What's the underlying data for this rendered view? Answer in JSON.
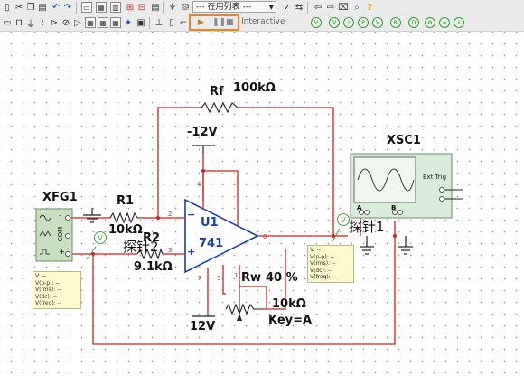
{
  "toolbar": {
    "in_use_list_label": "--- 在用列表 ---",
    "sim_run_icon": "play-icon",
    "sim_pause_icon": "pause-icon",
    "sim_stop_icon": "stop-icon",
    "interactive_label": "Interactive"
  },
  "schematic": {
    "function_generator": {
      "name": "XFG1",
      "terminals": [
        "-",
        "COM",
        "+"
      ]
    },
    "oscilloscope": {
      "name": "XSC1",
      "ext_trig_label": "Ext Trig",
      "channel_a": "A",
      "channel_b": "B"
    },
    "opamp": {
      "ref": "U1",
      "model": "741",
      "minus": "−",
      "plus": "+",
      "pins": [
        "2",
        "3",
        "4",
        "7",
        "6",
        "5",
        "1"
      ]
    },
    "rf": {
      "ref": "Rf",
      "value": "100kΩ"
    },
    "r1": {
      "ref": "R1",
      "value": "10kΩ"
    },
    "r2": {
      "ref": "R2",
      "value": "9.1kΩ"
    },
    "supply_neg": "-12V",
    "supply_pos": "12V",
    "rw": {
      "ref": "Rw",
      "percent": "40 %",
      "value": "10kΩ",
      "key": "Key=A"
    },
    "probe1": {
      "label": "探针1",
      "lines": [
        "V: --",
        "V(p-p): --",
        "V(rms): --",
        "V(dc): --",
        "V(freq): --"
      ]
    },
    "probe2": {
      "label": "探针2",
      "lines": [
        "V: --",
        "V(p-p): --",
        "V(rms): --",
        "V(dc): --",
        "V(freq): --"
      ]
    },
    "probe_letter": "V"
  },
  "colors": {
    "wire": "#cc2222",
    "label_blue": "#1b3fa6",
    "probe_green": "#3ea83e",
    "scope_green": "#d9ecd9",
    "highlight": "#e8862a"
  }
}
